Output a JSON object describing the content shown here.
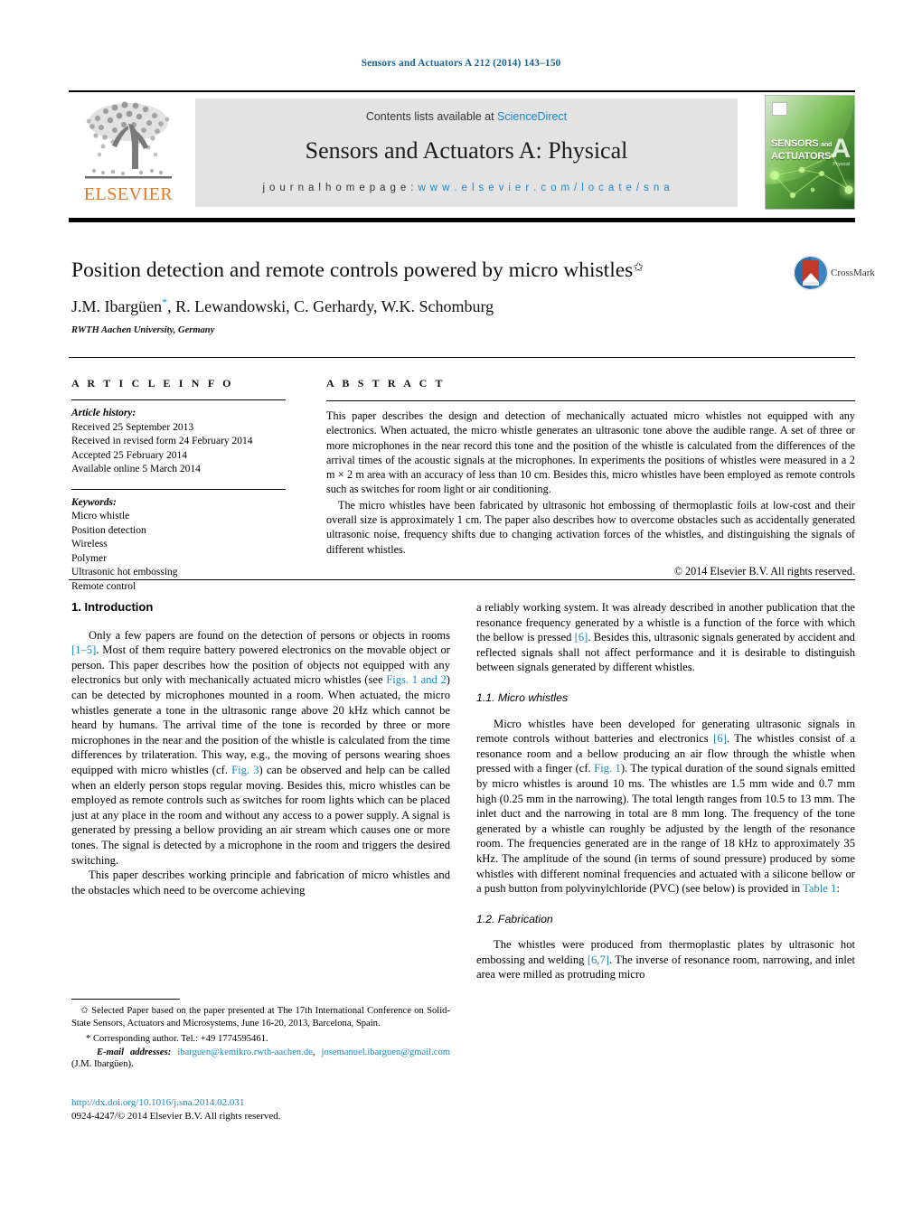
{
  "running_head": "Sensors and Actuators A 212 (2014) 143–150",
  "masthead": {
    "contents_prefix": "Contents lists available at ",
    "sciencedirect": "ScienceDirect",
    "journal_title": "Sensors and Actuators A: Physical",
    "homepage_prefix": "j o u r n a l    h o m e p a g e :  ",
    "homepage_url": "w w w . e l s e v i e r . c o m / l o c a t e / s n a",
    "publisher": "ELSEVIER",
    "publisher_color": "#E87722",
    "cover": {
      "line1": "SENSORS",
      "and": "and",
      "line2": "ACTUATORS",
      "letter": "A",
      "sub": "Physical"
    }
  },
  "article": {
    "title": "Position detection and remote controls powered by micro whistles",
    "title_marker": "✩",
    "authors": "J.M. Ibargüen",
    "author_marker": "*",
    "authors_rest": ", R. Lewandowski, C. Gerhardy, W.K. Schomburg",
    "affiliation": "RWTH Aachen University, Germany",
    "crossmark_label": "CrossMark"
  },
  "info": {
    "heading": "A R T I C L E   I N F O",
    "history_label": "Article history:",
    "history": [
      "Received 25 September 2013",
      "Received in revised form 24 February 2014",
      "Accepted 25 February 2014",
      "Available online 5 March 2014"
    ],
    "keywords_label": "Keywords:",
    "keywords": [
      "Micro whistle",
      "Position detection",
      "Wireless",
      "Polymer",
      "Ultrasonic hot embossing",
      "Remote control"
    ]
  },
  "abstract": {
    "heading": "A B S T R A C T",
    "paragraph1": "This paper describes the design and detection of mechanically actuated micro whistles not equipped with any electronics. When actuated, the micro whistle generates an ultrasonic tone above the audible range. A set of three or more microphones in the near record this tone and the position of the whistle is calculated from the differences of the arrival times of the acoustic signals at the microphones. In experiments the positions of whistles were measured in a 2 m × 2 m area with an accuracy of less than 10 cm. Besides this, micro whistles have been employed as remote controls such as switches for room light or air conditioning.",
    "paragraph2": "The micro whistles have been fabricated by ultrasonic hot embossing of thermoplastic foils at low-cost and their overall size is approximately 1 cm. The paper also describes how to overcome obstacles such as accidentally generated ultrasonic noise, frequency shifts due to changing activation forces of the whistles, and distinguishing the signals of different whistles.",
    "copyright": "© 2014 Elsevier B.V. All rights reserved."
  },
  "body": {
    "section1_heading": "1.  Introduction",
    "left_p1_a": "Only a few papers are found on the detection of persons or objects in rooms ",
    "left_p1_ref1": "[1–5]",
    "left_p1_b": ". Most of them require battery powered electronics on the movable object or person. This paper describes how the position of objects not equipped with any electronics but only with mechanically actuated micro whistles (see ",
    "left_p1_ref2": "Figs. 1 and 2",
    "left_p1_c": ") can be detected by microphones mounted in a room. When actuated, the micro whistles generate a tone in the ultrasonic range above 20 kHz which cannot be heard by humans. The arrival time of the tone is recorded by three or more microphones in the near and the position of the whistle is calculated from the time differences by trilateration. This way, e.g., the moving of persons wearing shoes equipped with micro whistles (cf. ",
    "left_p1_ref3": "Fig. 3",
    "left_p1_d": ") can be observed and help can be called when an elderly person stops regular moving. Besides this, micro whistles can be employed as remote controls such as switches for room lights which can be placed just at any place in the room and without any access to a power supply. A signal is generated by pressing a bellow providing an air stream which causes one or more tones. The signal is detected by a microphone in the room and triggers the desired switching.",
    "left_p2": "This paper describes working principle and fabrication of micro whistles and the obstacles which need to be overcome achieving",
    "right_p1_a": "a reliably working system. It was already described in another publication that the resonance frequency generated by a whistle is a function of the force with which the bellow is pressed ",
    "right_p1_ref": "[6]",
    "right_p1_b": ". Besides this, ultrasonic signals generated by accident and reflected signals shall not affect performance and it is desirable to distinguish between signals generated by different whistles.",
    "section11_heading": "1.1.  Micro whistles",
    "right_p2_a": "Micro whistles have been developed for generating ultrasonic signals in remote controls without batteries and electronics ",
    "right_p2_ref1": "[6]",
    "right_p2_b": ". The whistles consist of a resonance room and a bellow producing an air flow through the whistle when pressed with a finger (cf. ",
    "right_p2_ref2": "Fig. 1",
    "right_p2_c": "). The typical duration of the sound signals emitted by micro whistles is around 10 ms. The whistles are 1.5 mm wide and 0.7 mm high (0.25 mm in the narrowing). The total length ranges from 10.5 to 13 mm. The inlet duct and the narrowing in total are 8 mm long. The frequency of the tone generated by a whistle can roughly be adjusted by the length of the resonance room. The frequencies generated are in the range of 18 kHz to approximately 35 kHz. The amplitude of the sound (in terms of sound pressure) produced by some whistles with different nominal frequencies and actuated with a silicone bellow or a push button from polyvinylchloride (PVC) (see below) is provided in ",
    "right_p2_ref3": "Table 1",
    "right_p2_d": ":",
    "section12_heading": "1.2.  Fabrication",
    "right_p3_a": "The whistles were produced from thermoplastic plates by ultrasonic hot embossing and welding ",
    "right_p3_ref": "[6,7]",
    "right_p3_b": ". The inverse of resonance room, narrowing, and inlet area were milled as protruding micro"
  },
  "footnotes": {
    "star_symbol": "✩",
    "conference_note": " Selected Paper based on the paper presented at The 17th International Conference on Solid-State Sensors, Actuators and Microsystems, June 16-20, 2013, Barcelona, Spain.",
    "corresponding_symbol": "*",
    "corresponding_note": " Corresponding author. Tel.: +49 1774595461.",
    "email_label": "E-mail addresses:",
    "email1": "ibarguen@kemikro.rwth-aachen.de",
    "email_sep": ",",
    "email2": "josemanuel.ibarguen@gmail.com",
    "email_owner": " (J.M. Ibargüen)."
  },
  "doi": {
    "url": "http://dx.doi.org/10.1016/j.sna.2014.02.031",
    "issn_line": "0924-4247/© 2014 Elsevier B.V. All rights reserved."
  },
  "colors": {
    "link": "#1a87c8",
    "running_head": "#1a6496",
    "elsevier_orange": "#E87722"
  }
}
